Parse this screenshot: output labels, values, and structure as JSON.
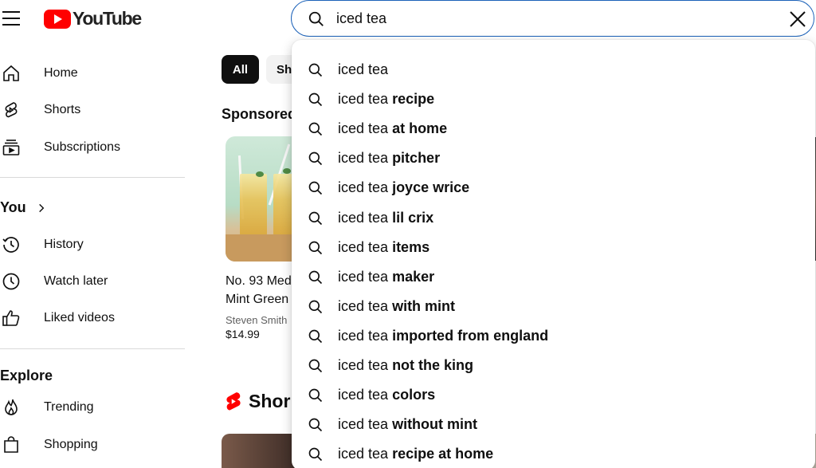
{
  "header": {
    "logo_text": "YouTube",
    "search_value": "iced tea"
  },
  "sidebar": {
    "main": [
      {
        "label": "Home",
        "icon": "home-icon"
      },
      {
        "label": "Shorts",
        "icon": "shorts-icon"
      },
      {
        "label": "Subscriptions",
        "icon": "subscriptions-icon"
      }
    ],
    "you_title": "You",
    "you": [
      {
        "label": "History",
        "icon": "history-icon"
      },
      {
        "label": "Watch later",
        "icon": "watch-later-icon"
      },
      {
        "label": "Liked videos",
        "icon": "thumbs-up-icon"
      }
    ],
    "explore_title": "Explore",
    "explore": [
      {
        "label": "Trending",
        "icon": "trending-icon"
      },
      {
        "label": "Shopping",
        "icon": "shopping-icon"
      }
    ]
  },
  "chips": [
    "All",
    "Sh"
  ],
  "feed": {
    "sponsored_label": "Sponsored",
    "card": {
      "title_line1": "No. 93 Med",
      "title_line2": "Mint Green",
      "seller": "Steven Smith",
      "price": "$14.99"
    },
    "shorts_label": "Shor"
  },
  "suggestions": [
    {
      "prefix": "iced tea",
      "suffix": ""
    },
    {
      "prefix": "iced tea",
      "suffix": "recipe"
    },
    {
      "prefix": "iced tea",
      "suffix": "at home"
    },
    {
      "prefix": "iced tea",
      "suffix": "pitcher"
    },
    {
      "prefix": "iced tea",
      "suffix": "joyce wrice"
    },
    {
      "prefix": "iced tea",
      "suffix": "lil crix"
    },
    {
      "prefix": "iced tea",
      "suffix": "items"
    },
    {
      "prefix": "iced tea",
      "suffix": "maker"
    },
    {
      "prefix": "iced tea",
      "suffix": "with mint"
    },
    {
      "prefix": "iced tea",
      "suffix": "imported from england"
    },
    {
      "prefix": "iced tea",
      "suffix": "not the king"
    },
    {
      "prefix": "iced tea",
      "suffix": "colors"
    },
    {
      "prefix": "iced tea",
      "suffix": "without mint"
    },
    {
      "prefix": "iced tea",
      "suffix": "recipe at home"
    }
  ],
  "colors": {
    "brand_red": "#ff0000",
    "search_focus": "#1c62b9",
    "text": "#0f0f0f",
    "secondary_text": "#606060"
  }
}
